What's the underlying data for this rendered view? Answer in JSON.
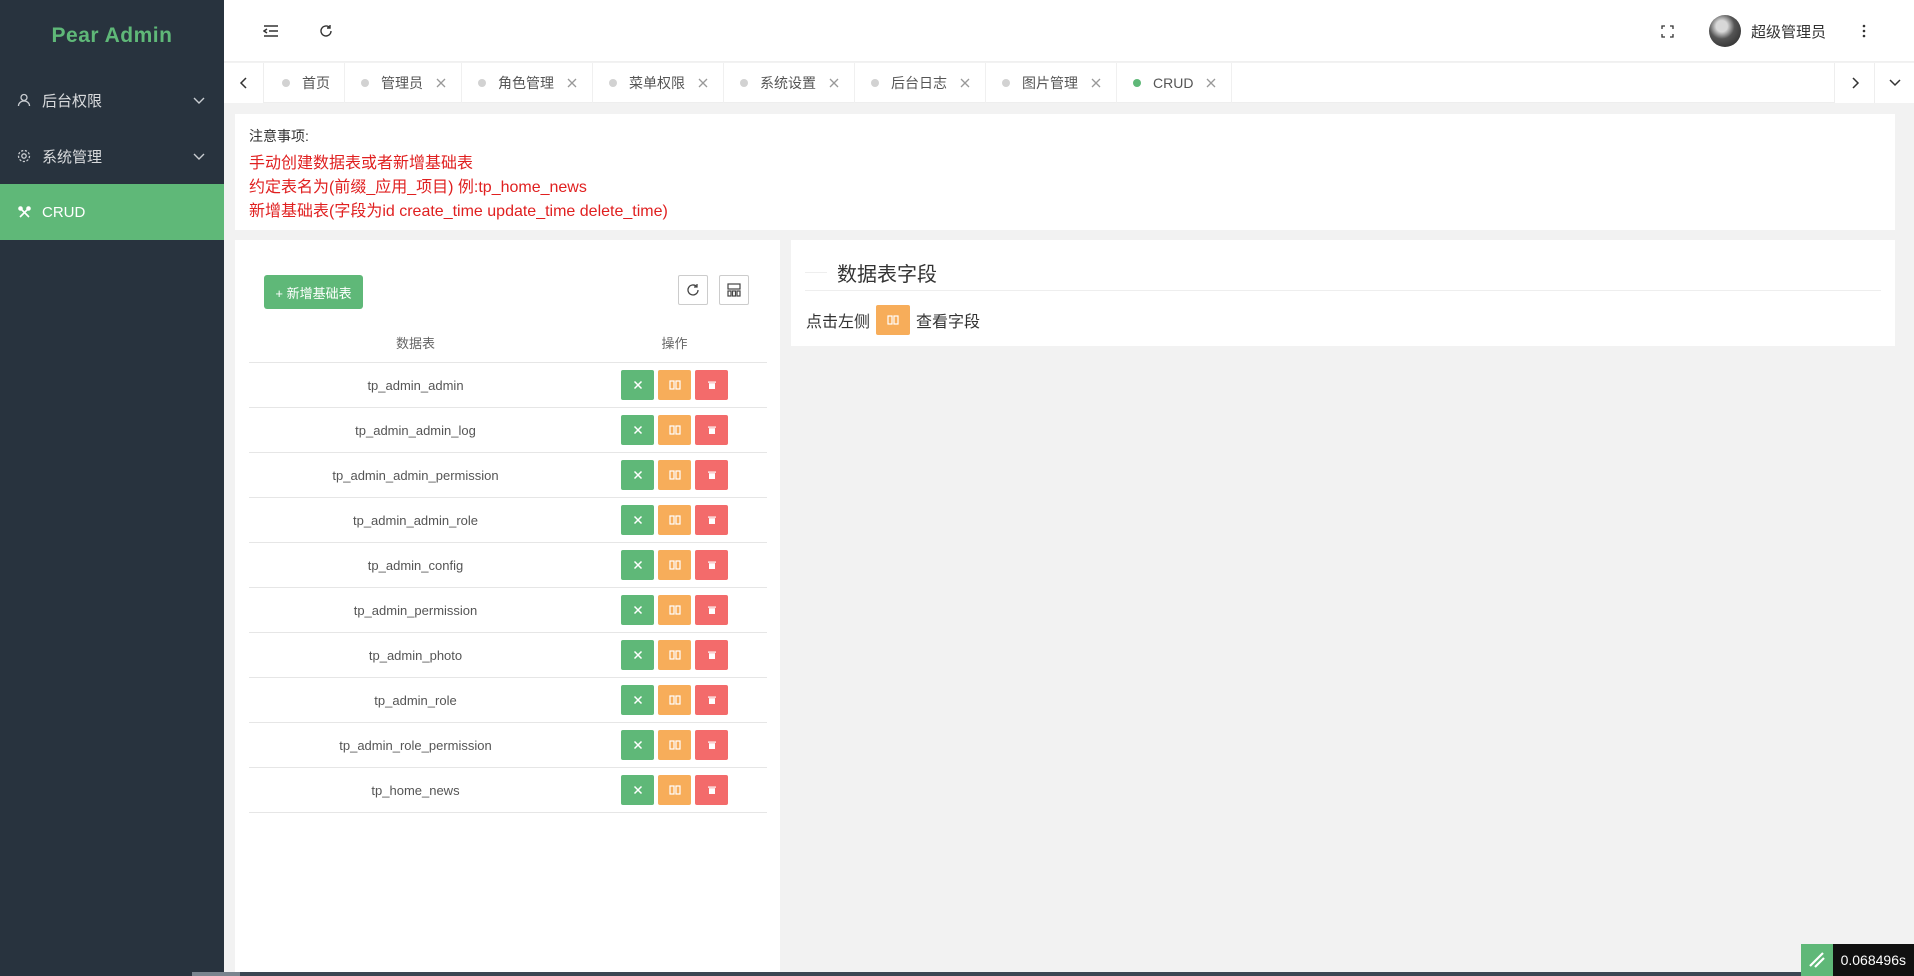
{
  "app": {
    "title": "Pear Admin",
    "brand_color": "#5fb878"
  },
  "sidebar": {
    "items": [
      {
        "label": "后台权限",
        "icon": "user-icon",
        "expandable": true
      },
      {
        "label": "系统管理",
        "icon": "gear-icon",
        "expandable": true
      },
      {
        "label": "CRUD",
        "icon": "tools-icon",
        "active": true
      }
    ]
  },
  "header": {
    "user_name": "超级管理员",
    "icons": [
      "menu-fold-icon",
      "refresh-icon",
      "fullscreen-icon",
      "globe-icon",
      "more-icon"
    ]
  },
  "tabs": [
    {
      "label": "首页",
      "closable": false
    },
    {
      "label": "管理员",
      "closable": true
    },
    {
      "label": "角色管理",
      "closable": true
    },
    {
      "label": "菜单权限",
      "closable": true
    },
    {
      "label": "系统设置",
      "closable": true
    },
    {
      "label": "后台日志",
      "closable": true
    },
    {
      "label": "图片管理",
      "closable": true
    },
    {
      "label": "CRUD",
      "closable": true,
      "active": true
    }
  ],
  "notice": {
    "title": "注意事项:",
    "lines": [
      "手动创建数据表或者新增基础表",
      "约定表名为(前缀_应用_项目) 例:tp_home_news",
      "新增基础表(字段为id create_time update_time delete_time)"
    ]
  },
  "left_panel": {
    "add_button": "+ 新增基础表",
    "columns": [
      "数据表",
      "操作"
    ],
    "rows": [
      "tp_admin_admin",
      "tp_admin_admin_log",
      "tp_admin_admin_permission",
      "tp_admin_admin_role",
      "tp_admin_config",
      "tp_admin_permission",
      "tp_admin_photo",
      "tp_admin_role",
      "tp_admin_role_permission",
      "tp_home_news"
    ]
  },
  "right_panel": {
    "title": "数据表字段",
    "hint_before": "点击左侧",
    "hint_after": "查看字段"
  },
  "perf": {
    "time": "0.068496s"
  }
}
